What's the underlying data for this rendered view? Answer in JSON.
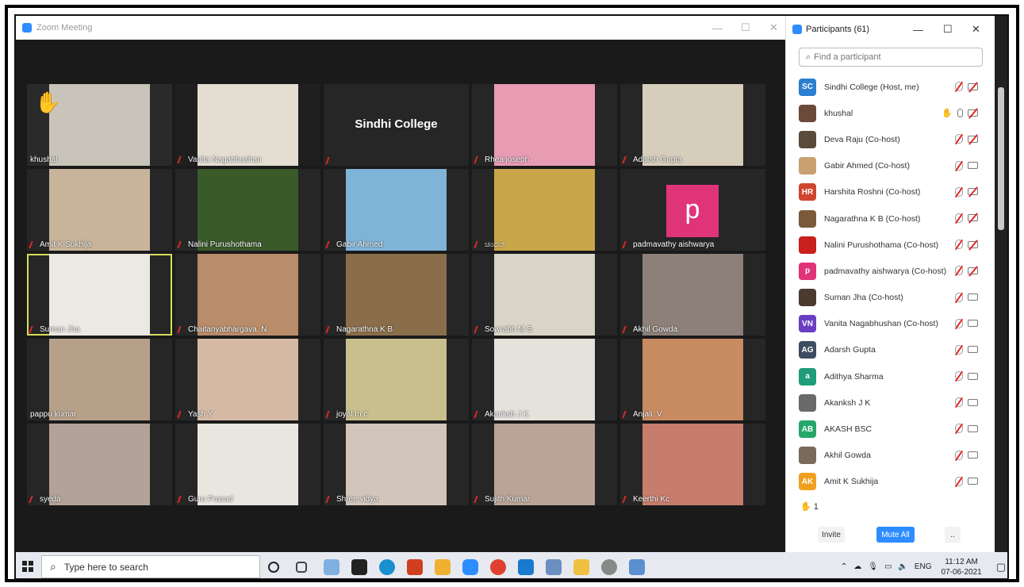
{
  "zoom_window": {
    "title": "Zoom Meeting",
    "controls": [
      "—",
      "☐",
      "✕"
    ]
  },
  "tiles": [
    {
      "name": "khushal",
      "muted": false,
      "hand": true,
      "bg": "#2a2a2a",
      "video": "#c9c4b9"
    },
    {
      "name": "Vanita Nagabhushan",
      "muted": true,
      "bg": "#1f1f1f",
      "video": "#e3ddd2"
    },
    {
      "name": "",
      "muted": true,
      "bg": "#262626",
      "label": "Sindhi College"
    },
    {
      "name": "Rhea joseph",
      "muted": true,
      "bg": "#262626",
      "video": "#e89cb4"
    },
    {
      "name": "Adarsh Gupta",
      "muted": true,
      "bg": "#262626",
      "video": "#d7cdbb"
    },
    {
      "name": "Amit K Sukhija",
      "muted": true,
      "bg": "#262626",
      "video": "#c8b49b"
    },
    {
      "name": "Nalini Purushothama",
      "muted": true,
      "bg": "#262626",
      "video": "#3a5a2a"
    },
    {
      "name": "Gabir Ahmed",
      "muted": true,
      "bg": "#262626",
      "video": "#7fb4d8"
    },
    {
      "name": "ಚಂದನ್",
      "muted": true,
      "bg": "#262626",
      "video": "#c9a64a"
    },
    {
      "name": "padmavathy aishwarya",
      "muted": true,
      "bg": "#262626",
      "letter": "p"
    },
    {
      "name": "Suman Jha",
      "muted": true,
      "bg": "#262626",
      "video": "#ece8e4",
      "active": true
    },
    {
      "name": "Chaitanyabhargava. N",
      "muted": true,
      "bg": "#262626",
      "video": "#b98c6a"
    },
    {
      "name": "Nagarathna K B",
      "muted": true,
      "bg": "#262626",
      "video": "#8a6d4a"
    },
    {
      "name": "Sowrabh M S",
      "muted": true,
      "bg": "#262626",
      "video": "#d9d4c8"
    },
    {
      "name": "Akhil Gowda",
      "muted": true,
      "bg": "#262626",
      "video": "#8c8078"
    },
    {
      "name": "pappu kumar",
      "muted": false,
      "bg": "#262626",
      "video": "#b7a08a"
    },
    {
      "name": "Yash Y",
      "muted": true,
      "bg": "#262626",
      "video": "#d6b9a4"
    },
    {
      "name": "joyal m c",
      "muted": true,
      "bg": "#262626",
      "video": "#c9bf8c"
    },
    {
      "name": "Akanksh J K",
      "muted": true,
      "bg": "#262626",
      "video": "#e5e2dc"
    },
    {
      "name": "Anjali. V",
      "muted": true,
      "bg": "#262626",
      "video": "#c98b62"
    },
    {
      "name": "syeda",
      "muted": true,
      "bg": "#262626",
      "video": "#b3a29a"
    },
    {
      "name": "Guru Prasad",
      "muted": true,
      "bg": "#262626",
      "video": "#e9e5df"
    },
    {
      "name": "Shree vidya",
      "muted": true,
      "bg": "#262626",
      "video": "#d2c6bc"
    },
    {
      "name": "Sujith Kumar",
      "muted": true,
      "bg": "#262626",
      "video": "#b9a496"
    },
    {
      "name": "Keerthi Kc",
      "muted": true,
      "bg": "#262626",
      "video": "#c77d6c"
    }
  ],
  "panel": {
    "title": "Participants (61)",
    "controls": [
      "—",
      "☐",
      "✕"
    ],
    "search_placeholder": "Find a participant",
    "participants": [
      {
        "name": "Sindhi College (Host, me)",
        "initials": "SC",
        "color": "#2a7fd0",
        "cam_off": true
      },
      {
        "name": "khushal",
        "initials": "",
        "color": "#6b4a3a",
        "cam_off": true,
        "hand": true,
        "mic_on": true
      },
      {
        "name": "Deva Raju (Co-host)",
        "initials": "",
        "color": "#5a4a3a",
        "cam_off": true
      },
      {
        "name": "Gabir Ahmed (Co-host)",
        "initials": "",
        "color": "#c9a070",
        "cam_off": false
      },
      {
        "name": "Harshita Roshni (Co-host)",
        "initials": "HR",
        "color": "#d0452f",
        "cam_off": true
      },
      {
        "name": "Nagarathna K B (Co-host)",
        "initials": "",
        "color": "#7a5a3a",
        "cam_off": true
      },
      {
        "name": "Nalini Purushothama (Co-host)",
        "initials": "",
        "color": "#c8201c",
        "cam_off": true
      },
      {
        "name": "padmavathy aishwarya (Co-host)",
        "initials": "p",
        "color": "#e0347a",
        "cam_off": true
      },
      {
        "name": "Suman Jha (Co-host)",
        "initials": "",
        "color": "#4a3a30",
        "cam_off": false
      },
      {
        "name": "Vanita Nagabhushan (Co-host)",
        "initials": "VN",
        "color": "#6a3fc2",
        "cam_off": false
      },
      {
        "name": "Adarsh Gupta",
        "initials": "AG",
        "color": "#3d4c5f",
        "cam_off": false
      },
      {
        "name": "Adithya Sharma",
        "initials": "a",
        "color": "#1f9c7a",
        "cam_off": false
      },
      {
        "name": "Akanksh J K",
        "initials": "",
        "color": "#6a6a6a",
        "cam_off": false
      },
      {
        "name": "AKASH BSC",
        "initials": "AB",
        "color": "#24a86a",
        "cam_off": false
      },
      {
        "name": "Akhil Gowda",
        "initials": "",
        "color": "#7a6a5a",
        "cam_off": false
      },
      {
        "name": "Amit K Sukhija",
        "initials": "AK",
        "color": "#f0a020",
        "cam_off": false
      }
    ],
    "hands_count": "1",
    "invite_label": "Invite",
    "mute_all_label": "Mute All",
    "more_label": ".."
  },
  "taskbar": {
    "search_placeholder": "Type here to search",
    "lang": "ENG",
    "time": "11:12 AM",
    "date": "07-06-2021"
  }
}
